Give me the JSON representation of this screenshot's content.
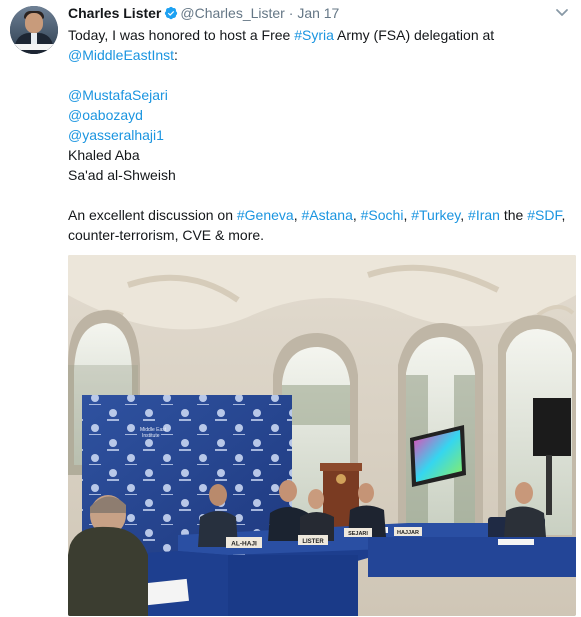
{
  "tweet": {
    "author_name": "Charles Lister",
    "handle": "@Charles_Lister",
    "separator": "·",
    "date": "Jan 17",
    "line1_pre": "Today, I was honored to host a Free ",
    "line1_tag": "#Syria",
    "line1_post": " Army (FSA) delegation at",
    "mention_org": "@MiddleEastInst",
    "colon": ":",
    "mentions": [
      "@MustafaSejari",
      "@oabozayd",
      "@yasseralhaji1"
    ],
    "names": [
      "Khaled Aba",
      "Sa'ad al-Shweish"
    ],
    "discussion_pre": "An excellent discussion on ",
    "hashtags": [
      "#Geneva",
      "#Astana",
      "#Sochi",
      "#Turkey",
      "#Iran"
    ],
    "comma": ", ",
    "the": " the ",
    "hashtag_last": "#SDF",
    "comma_end": ",",
    "line_last": "counter-terrorism, CVE & more."
  },
  "photo": {
    "backdrop_brand": [
      "Middle East",
      "Institute"
    ],
    "name_cards": [
      "AL-HAJI",
      "LISTER",
      "SEJARI",
      "HAJJAR"
    ]
  },
  "icons": {
    "verified": "verified-badge-icon",
    "menu": "chevron-down-icon"
  },
  "colors": {
    "link": "#1b95e0",
    "text": "#14171a",
    "muted": "#657786",
    "verified": "#1da1f2"
  }
}
